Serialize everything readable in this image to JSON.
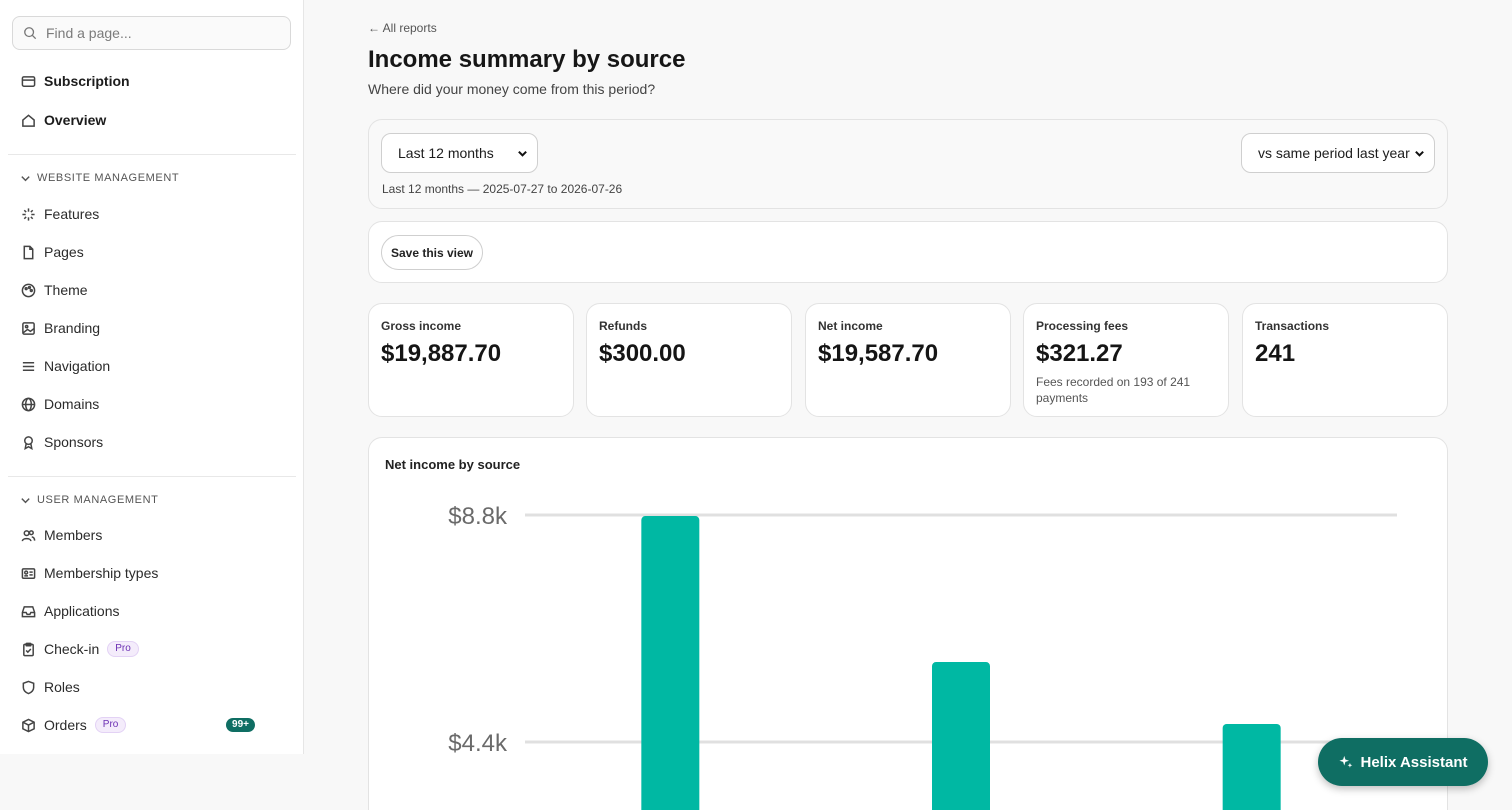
{
  "sidebar": {
    "search": {
      "placeholder": "Find a page..."
    },
    "top_items": [
      {
        "label": "Subscription",
        "icon": "card-icon"
      },
      {
        "label": "Overview",
        "icon": "home-icon"
      }
    ],
    "sections": [
      {
        "title": "WEBSITE MANAGEMENT",
        "items": [
          {
            "label": "Features",
            "icon": "sparkle-icon"
          },
          {
            "label": "Pages",
            "icon": "file-icon"
          },
          {
            "label": "Theme",
            "icon": "palette-icon"
          },
          {
            "label": "Branding",
            "icon": "image-icon"
          },
          {
            "label": "Navigation",
            "icon": "menu-icon"
          },
          {
            "label": "Domains",
            "icon": "globe-icon"
          },
          {
            "label": "Sponsors",
            "icon": "ribbon-icon"
          }
        ]
      },
      {
        "title": "USER MANAGEMENT",
        "items": [
          {
            "label": "Members",
            "icon": "users-icon"
          },
          {
            "label": "Membership types",
            "icon": "id-card-icon"
          },
          {
            "label": "Applications",
            "icon": "inbox-icon"
          },
          {
            "label": "Check-in",
            "icon": "clipboard-check-icon",
            "badge": "Pro"
          },
          {
            "label": "Roles",
            "icon": "shield-icon"
          },
          {
            "label": "Orders",
            "icon": "box-icon",
            "badge": "Pro",
            "count": "99+"
          }
        ]
      }
    ]
  },
  "header": {
    "back_link": "← All reports",
    "title": "Income summary by source",
    "subtitle": "Where did your money come from this period?"
  },
  "filters": {
    "period": "Last 12 months",
    "comparison": "vs same period last year",
    "range_note": "Last 12 months — 2025-07-27 to 2026-07-26",
    "save_label": "Save this view"
  },
  "kpis": [
    {
      "label": "Gross income",
      "value": "$19,887.70",
      "note": ""
    },
    {
      "label": "Refunds",
      "value": "$300.00",
      "note": ""
    },
    {
      "label": "Net income",
      "value": "$19,587.70",
      "note": ""
    },
    {
      "label": "Processing fees",
      "value": "$321.27",
      "note": "Fees recorded on 193 of 241 payments"
    },
    {
      "label": "Transactions",
      "value": "241",
      "note": ""
    }
  ],
  "chart_title": "Net income by source",
  "chart_data": {
    "type": "bar",
    "title": "",
    "categories": [
      "",
      "",
      ""
    ],
    "values": [
      8780,
      5950,
      4750
    ],
    "y_ticks": [
      {
        "value": 8800,
        "label": "$8.8k"
      },
      {
        "value": 4400,
        "label": "$4.4k"
      }
    ],
    "bar_color": "#00b8a3",
    "grid": true
  },
  "assistant": {
    "label": "Helix Assistant"
  },
  "colors": {
    "accent": "#0f6e63",
    "bar": "#00b8a3",
    "pro_text": "#6b2fb3"
  }
}
